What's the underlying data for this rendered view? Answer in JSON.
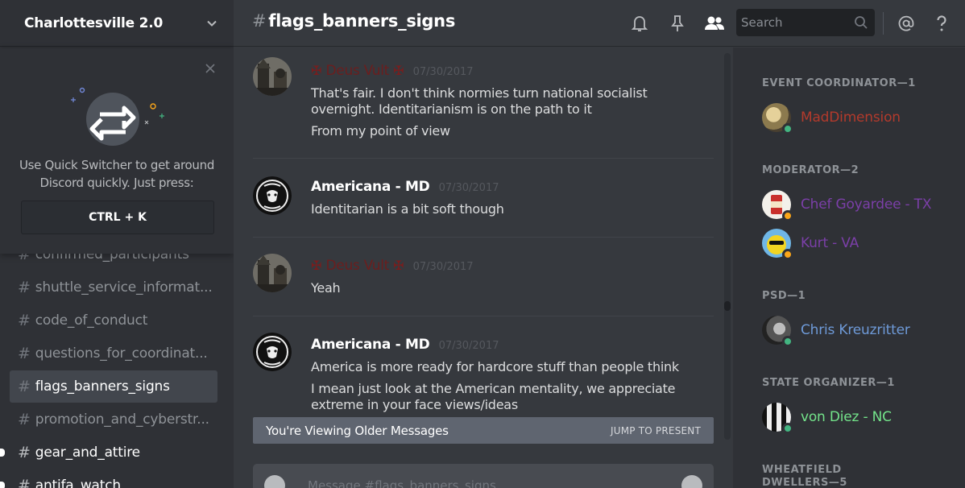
{
  "guild": {
    "name": "Charlottesville 2.0"
  },
  "quick_switcher": {
    "text_line1": "Use Quick Switcher to get around",
    "text_line2": "Discord quickly. Just press:",
    "shortcut": "CTRL + K"
  },
  "channels": [
    {
      "name": "confirmed_participants",
      "state": "normal"
    },
    {
      "name": "shuttle_service_informat...",
      "state": "normal"
    },
    {
      "name": "code_of_conduct",
      "state": "normal"
    },
    {
      "name": "questions_for_coordinat...",
      "state": "normal"
    },
    {
      "name": "flags_banners_signs",
      "state": "active"
    },
    {
      "name": "promotion_and_cyberstr...",
      "state": "normal"
    },
    {
      "name": "gear_and_attire",
      "state": "unread"
    },
    {
      "name": "antifa_watch",
      "state": "unread"
    }
  ],
  "header": {
    "hash": "#",
    "channel": "flags_banners_signs",
    "search_placeholder": "Search",
    "icons": [
      "bell-icon",
      "pin-icon",
      "members-icon",
      "search-icon",
      "mention-icon",
      "help-icon"
    ]
  },
  "messages": [
    {
      "author": "Deus Vult",
      "author_prefix": "✠",
      "author_suffix": "✠",
      "author_color": "#6b1e1e",
      "timestamp": "07/30/2017",
      "lines": [
        "That's fair. I don't think normies turn national socialist overnight. Identitarianism is on the path to it",
        "From my point of view"
      ]
    },
    {
      "author": "Americana - MD",
      "author_color": "#ffffff",
      "timestamp": "07/30/2017",
      "lines": [
        "Identitarian is a bit soft though"
      ]
    },
    {
      "author": "Deus Vult",
      "author_prefix": "✠",
      "author_suffix": "✠",
      "author_color": "#6b1e1e",
      "timestamp": "07/30/2017",
      "lines": [
        "Yeah"
      ]
    },
    {
      "author": "Americana - MD",
      "author_color": "#ffffff",
      "timestamp": "07/30/2017",
      "lines": [
        "America is more ready for hardcore stuff than people think",
        "I mean just look at the American mentality, we appreciate extreme in your face views/ideas"
      ]
    }
  ],
  "older_bar": {
    "text": "You're Viewing Older Messages",
    "action": "JUMP TO PRESENT"
  },
  "composer": {
    "placeholder": "Message #flags_banners_signs"
  },
  "member_list": [
    {
      "role": "EVENT COORDINATOR—1",
      "members": [
        {
          "name": "MadDimension",
          "color": "#b33a2c",
          "status": "online"
        }
      ]
    },
    {
      "role": "MODERATOR—2",
      "members": [
        {
          "name": "Chef Goyardee - TX",
          "color": "#7b3fa8",
          "status": "idle"
        },
        {
          "name": "Kurt - VA",
          "color": "#7b3fa8",
          "status": "idle"
        }
      ]
    },
    {
      "role": "PSD—1",
      "members": [
        {
          "name": "Chris Kreuzritter",
          "color": "#6e9ad8",
          "status": "online"
        }
      ]
    },
    {
      "role": "STATE ORGANIZER—1",
      "members": [
        {
          "name": "von Diez - NC",
          "color": "#73e38a",
          "status": "online"
        }
      ]
    },
    {
      "role": "WHEATFIELD DWELLERS—5",
      "members": []
    }
  ]
}
